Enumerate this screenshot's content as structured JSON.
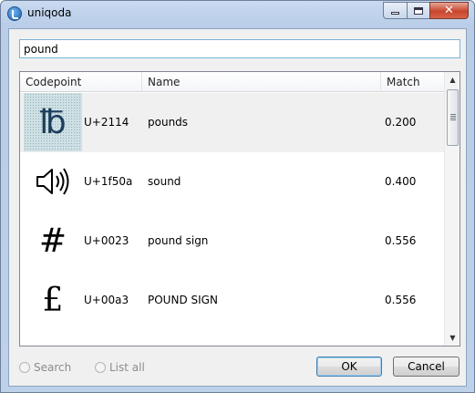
{
  "window": {
    "title": "uniqoda",
    "close_glyph": "✕"
  },
  "search": {
    "value": "pound"
  },
  "columns": {
    "codepoint": "Codepoint",
    "name": "Name",
    "match": "Match"
  },
  "rows": [
    {
      "glyph": "℔",
      "codepoint": "U+2114",
      "name": "pounds",
      "match": "0.200"
    },
    {
      "glyph": "🔊",
      "codepoint": "U+1f50a",
      "name": "sound",
      "match": "0.400"
    },
    {
      "glyph": "#",
      "codepoint": "U+0023",
      "name": "pound sign",
      "match": "0.556"
    },
    {
      "glyph": "£",
      "codepoint": "U+00a3",
      "name": "POUND SIGN",
      "match": "0.556"
    }
  ],
  "scrollbar": {
    "up_arrow": "▲",
    "down_arrow": "▼"
  },
  "modes": {
    "search_label": "Search",
    "list_all_label": "List all"
  },
  "buttons": {
    "ok_label": "OK",
    "cancel_label": "Cancel"
  }
}
